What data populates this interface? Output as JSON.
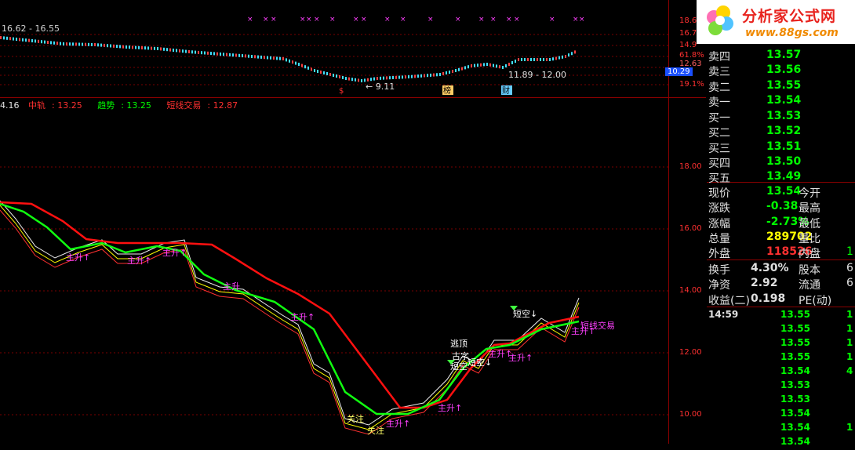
{
  "top_chart": {
    "range_text": "16.62 - 16.55",
    "y_labels": [
      "18.6",
      "16.7",
      "14.9",
      "61.8%",
      "12.63",
      "10.29",
      "19.1%"
    ],
    "low_label": "9.11",
    "low_arrow": "←",
    "range_right": "11.89 - 12.00",
    "markers": [
      "$",
      "榜",
      "财"
    ]
  },
  "indicator": {
    "prefix": "4.16",
    "zhonggui_label": "中轨",
    "zhonggui_value": "13.25",
    "qushi_label": "趋势",
    "qushi_value": "13.25",
    "duanxian_label": "短线交易",
    "duanxian_value": "12.87"
  },
  "main_chart": {
    "y_labels": [
      "18.00",
      "16.00",
      "14.00",
      "12.00",
      "10.00"
    ],
    "annotations": [
      "主升↑",
      "主升↑",
      "主升↑",
      "主升",
      "主升↑",
      "关注",
      "关注",
      "主升↑",
      "主升↑",
      "逃顶",
      "古字",
      "短空",
      "短空↓",
      "主升↑",
      "主升↑",
      "短空↓",
      "主升↑",
      "短线交易"
    ]
  },
  "quote_panel": {
    "sell": [
      {
        "label": "卖四",
        "price": "13.57"
      },
      {
        "label": "卖三",
        "price": "13.56"
      },
      {
        "label": "卖二",
        "price": "13.55"
      },
      {
        "label": "卖一",
        "price": "13.54"
      }
    ],
    "buy": [
      {
        "label": "买一",
        "price": "13.53"
      },
      {
        "label": "买二",
        "price": "13.52"
      },
      {
        "label": "买三",
        "price": "13.51"
      },
      {
        "label": "买四",
        "price": "13.50"
      },
      {
        "label": "买五",
        "price": "13.49"
      }
    ],
    "stats": [
      {
        "label": "现价",
        "value": "13.54",
        "label2": "今开",
        "extra": "",
        "color": "#00ff00"
      },
      {
        "label": "涨跌",
        "value": "-0.38",
        "label2": "最高",
        "extra": "",
        "color": "#00ff00"
      },
      {
        "label": "涨幅",
        "value": "-2.73%",
        "label2": "最低",
        "extra": "",
        "color": "#00ff00"
      },
      {
        "label": "总量",
        "value": "289702",
        "label2": "量比",
        "extra": "",
        "color": "#ffff00"
      },
      {
        "label": "外盘",
        "value": "118526",
        "label2": "内盘",
        "extra": "1",
        "color": "#ff3030"
      }
    ],
    "stats2": [
      {
        "label": "换手",
        "value": "4.30%",
        "label2": "股本",
        "extra": "6",
        "color": "#e0e0e0"
      },
      {
        "label": "净资",
        "value": "2.92",
        "label2": "流通",
        "extra": "6",
        "color": "#e0e0e0"
      },
      {
        "label": "收益(二)",
        "value": "0.198",
        "label2": "PE(动)",
        "extra": "",
        "color": "#e0e0e0"
      }
    ],
    "ticks": [
      {
        "time": "14:59",
        "price": "13.55",
        "vol": "1"
      },
      {
        "time": "",
        "price": "13.55",
        "vol": "1"
      },
      {
        "time": "",
        "price": "13.55",
        "vol": "1"
      },
      {
        "time": "",
        "price": "13.55",
        "vol": "1"
      },
      {
        "time": "",
        "price": "13.54",
        "vol": "4"
      },
      {
        "time": "",
        "price": "13.53",
        "vol": ""
      },
      {
        "time": "",
        "price": "13.53",
        "vol": ""
      },
      {
        "time": "",
        "price": "13.54",
        "vol": ""
      },
      {
        "time": "",
        "price": "13.54",
        "vol": "1"
      },
      {
        "time": "",
        "price": "13.54",
        "vol": ""
      }
    ]
  },
  "logo": {
    "text": "分析家公式网",
    "url_text": "www.88gs.com"
  },
  "colors": {
    "red": "#ff2020",
    "green": "#00ff00",
    "yellow": "#ffff00",
    "magenta": "#ff40ff",
    "grid": "#8b0000"
  }
}
